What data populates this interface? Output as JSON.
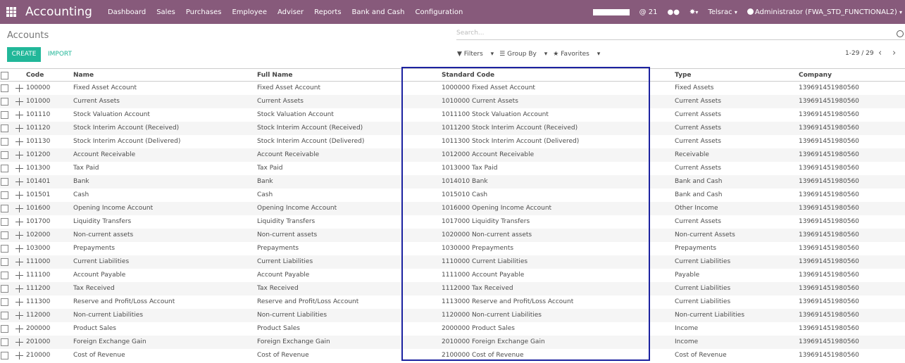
{
  "nav": {
    "brand": "Accounting",
    "menu": [
      "Dashboard",
      "Sales",
      "Purchases",
      "Employee",
      "Adviser",
      "Reports",
      "Bank and Cash",
      "Configuration"
    ],
    "activity_count": "@ 21",
    "company_switch": "Telsrac",
    "user": "Administrator (FWA_STD_FUNCTIONAL2)"
  },
  "control": {
    "title": "Accounts",
    "create_label": "CREATE",
    "import_label": "IMPORT",
    "search_placeholder": "Search...",
    "filters_label": "Filters",
    "groupby_label": "Group By",
    "favorites_label": "Favorites",
    "pager": "1-29 / 29"
  },
  "table": {
    "headers": {
      "code": "Code",
      "name": "Name",
      "full_name": "Full Name",
      "standard_code": "Standard Code",
      "type": "Type",
      "company": "Company"
    },
    "rows": [
      {
        "code": "100000",
        "name": "Fixed Asset Account",
        "full_name": "Fixed Asset Account",
        "standard_code": "1000000 Fixed Asset Account",
        "type": "Fixed Assets",
        "company": "139691451980560"
      },
      {
        "code": "101000",
        "name": "Current Assets",
        "full_name": "Current Assets",
        "standard_code": "1010000 Current Assets",
        "type": "Current Assets",
        "company": "139691451980560"
      },
      {
        "code": "101110",
        "name": "Stock Valuation Account",
        "full_name": "Stock Valuation Account",
        "standard_code": "1011100 Stock Valuation Account",
        "type": "Current Assets",
        "company": "139691451980560"
      },
      {
        "code": "101120",
        "name": "Stock Interim Account (Received)",
        "full_name": "Stock Interim Account (Received)",
        "standard_code": "1011200 Stock Interim Account (Received)",
        "type": "Current Assets",
        "company": "139691451980560"
      },
      {
        "code": "101130",
        "name": "Stock Interim Account (Delivered)",
        "full_name": "Stock Interim Account (Delivered)",
        "standard_code": "1011300 Stock Interim Account (Delivered)",
        "type": "Current Assets",
        "company": "139691451980560"
      },
      {
        "code": "101200",
        "name": "Account Receivable",
        "full_name": "Account Receivable",
        "standard_code": "1012000 Account Receivable",
        "type": "Receivable",
        "company": "139691451980560"
      },
      {
        "code": "101300",
        "name": "Tax Paid",
        "full_name": "Tax Paid",
        "standard_code": "1013000 Tax Paid",
        "type": "Current Assets",
        "company": "139691451980560"
      },
      {
        "code": "101401",
        "name": "Bank",
        "full_name": "Bank",
        "standard_code": "1014010 Bank",
        "type": "Bank and Cash",
        "company": "139691451980560"
      },
      {
        "code": "101501",
        "name": "Cash",
        "full_name": "Cash",
        "standard_code": "1015010 Cash",
        "type": "Bank and Cash",
        "company": "139691451980560"
      },
      {
        "code": "101600",
        "name": "Opening Income Account",
        "full_name": "Opening Income Account",
        "standard_code": "1016000 Opening Income Account",
        "type": "Other Income",
        "company": "139691451980560"
      },
      {
        "code": "101700",
        "name": "Liquidity Transfers",
        "full_name": "Liquidity Transfers",
        "standard_code": "1017000 Liquidity Transfers",
        "type": "Current Assets",
        "company": "139691451980560"
      },
      {
        "code": "102000",
        "name": "Non-current assets",
        "full_name": "Non-current assets",
        "standard_code": "1020000 Non-current assets",
        "type": "Non-current Assets",
        "company": "139691451980560"
      },
      {
        "code": "103000",
        "name": "Prepayments",
        "full_name": "Prepayments",
        "standard_code": "1030000 Prepayments",
        "type": "Prepayments",
        "company": "139691451980560"
      },
      {
        "code": "111000",
        "name": "Current Liabilities",
        "full_name": "Current Liabilities",
        "standard_code": "1110000 Current Liabilities",
        "type": "Current Liabilities",
        "company": "139691451980560"
      },
      {
        "code": "111100",
        "name": "Account Payable",
        "full_name": "Account Payable",
        "standard_code": "1111000 Account Payable",
        "type": "Payable",
        "company": "139691451980560"
      },
      {
        "code": "111200",
        "name": "Tax Received",
        "full_name": "Tax Received",
        "standard_code": "1112000 Tax Received",
        "type": "Current Liabilities",
        "company": "139691451980560"
      },
      {
        "code": "111300",
        "name": "Reserve and Profit/Loss Account",
        "full_name": "Reserve and Profit/Loss Account",
        "standard_code": "1113000 Reserve and Profit/Loss Account",
        "type": "Current Liabilities",
        "company": "139691451980560"
      },
      {
        "code": "112000",
        "name": "Non-current Liabilities",
        "full_name": "Non-current Liabilities",
        "standard_code": "1120000 Non-current Liabilities",
        "type": "Non-current Liabilities",
        "company": "139691451980560"
      },
      {
        "code": "200000",
        "name": "Product Sales",
        "full_name": "Product Sales",
        "standard_code": "2000000 Product Sales",
        "type": "Income",
        "company": "139691451980560"
      },
      {
        "code": "201000",
        "name": "Foreign Exchange Gain",
        "full_name": "Foreign Exchange Gain",
        "standard_code": "2010000 Foreign Exchange Gain",
        "type": "Income",
        "company": "139691451980560"
      },
      {
        "code": "210000",
        "name": "Cost of Revenue",
        "full_name": "Cost of Revenue",
        "standard_code": "2100000 Cost of Revenue",
        "type": "Cost of Revenue",
        "company": "139691451980560"
      }
    ]
  },
  "colors": {
    "nav_bg": "#875a7b",
    "accent": "#21b799",
    "highlight": "#1c22a0"
  }
}
